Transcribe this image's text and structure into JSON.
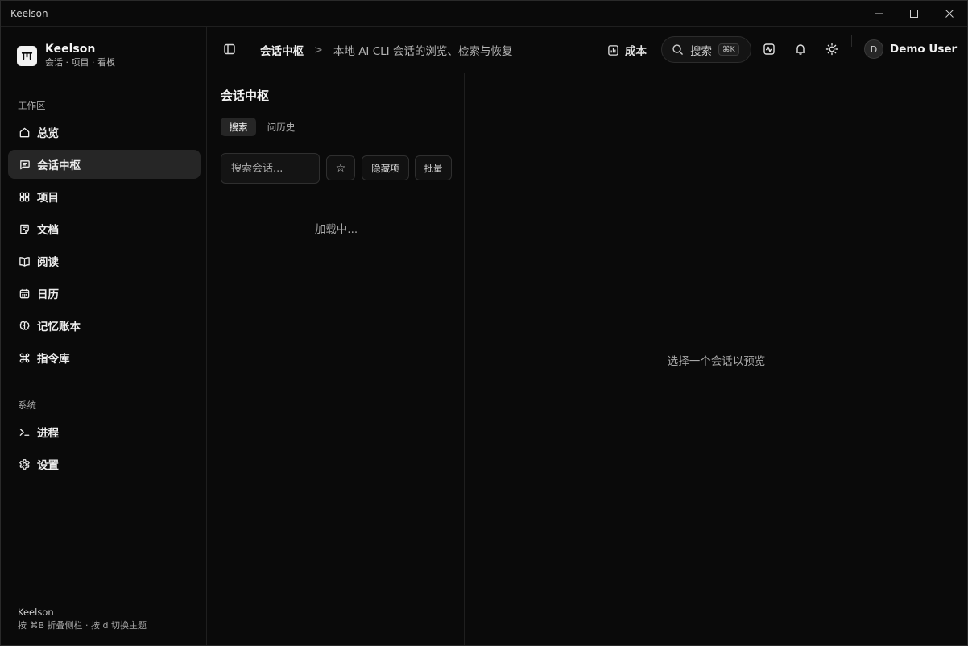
{
  "window": {
    "title": "Keelson"
  },
  "brand": {
    "name": "Keelson",
    "subtitle": "会话 · 项目 · 看板"
  },
  "sidebar": {
    "workspace_label": "工作区",
    "workspace_items": [
      {
        "label": "总览",
        "icon": "home-icon"
      },
      {
        "label": "会话中枢",
        "icon": "chat-icon",
        "active": true
      },
      {
        "label": "项目",
        "icon": "grid-icon"
      },
      {
        "label": "文档",
        "icon": "note-icon"
      },
      {
        "label": "阅读",
        "icon": "book-icon"
      },
      {
        "label": "日历",
        "icon": "calendar-icon"
      },
      {
        "label": "记忆账本",
        "icon": "brain-icon"
      },
      {
        "label": "指令库",
        "icon": "command-icon"
      }
    ],
    "system_label": "系统",
    "system_items": [
      {
        "label": "进程",
        "icon": "terminal-icon"
      },
      {
        "label": "设置",
        "icon": "gear-icon"
      }
    ],
    "footer": {
      "title": "Keelson",
      "hint": "按 ⌘B 折叠侧栏 · 按 d 切换主题"
    }
  },
  "header": {
    "breadcrumb_current": "会话中枢",
    "breadcrumb_separator": ">",
    "breadcrumb_description": "本地 AI CLI 会话的浏览、检索与恢复",
    "cost_label": "成本",
    "search_label": "搜索",
    "search_shortcut": "⌘K",
    "user": {
      "initial": "D",
      "name": "Demo User"
    }
  },
  "list_pane": {
    "title": "会话中枢",
    "tabs": [
      {
        "label": "搜索",
        "active": true
      },
      {
        "label": "问历史",
        "active": false
      }
    ],
    "search_placeholder": "搜索会话...",
    "star_glyph": "☆",
    "hidden_button": "隐藏项",
    "batch_button": "批量",
    "loading_text": "加载中..."
  },
  "preview_pane": {
    "empty_text": "选择一个会话以预览"
  }
}
